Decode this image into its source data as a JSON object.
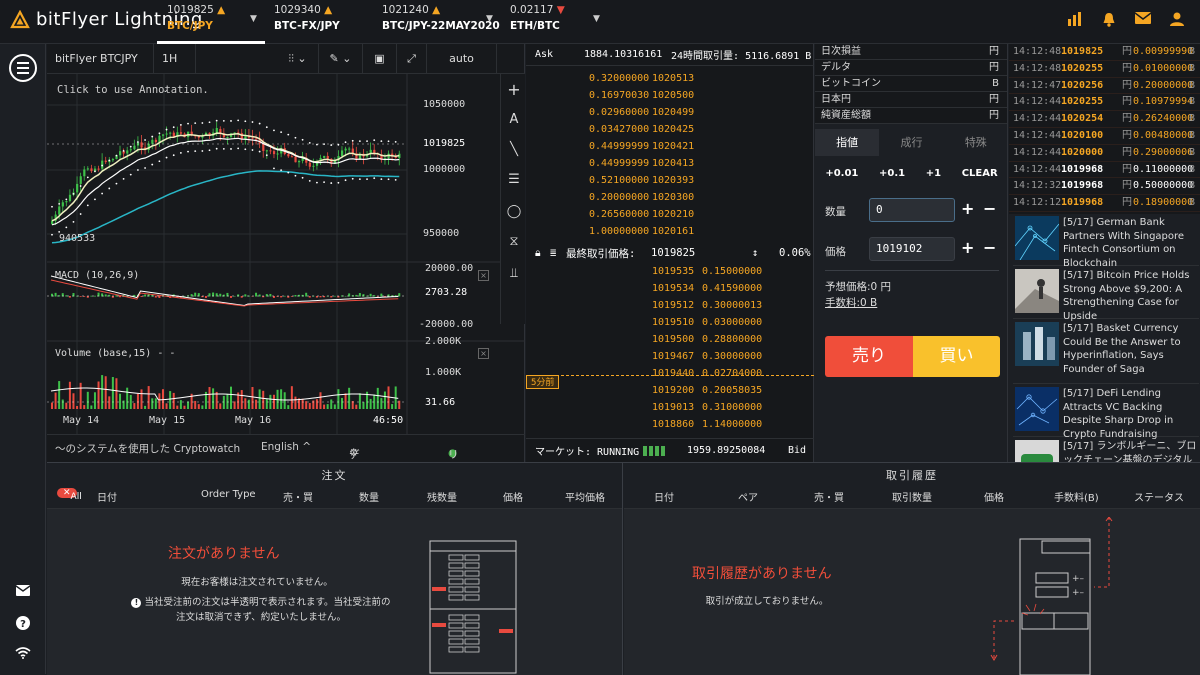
{
  "header": {
    "logo_text": "bitFlyer Lightning",
    "tickers": [
      {
        "price": "1019825",
        "arrow": "up",
        "symbol": "BTC/JPY",
        "active": true
      },
      {
        "price": "1029340",
        "arrow": "up",
        "symbol": "BTC-FX/JPY",
        "active": false
      },
      {
        "price": "1021240",
        "arrow": "up",
        "symbol": "BTC/JPY-22MAY2020",
        "active": false
      },
      {
        "price": "0.02117",
        "arrow": "down",
        "symbol": "ETH/BTC",
        "active": false
      }
    ],
    "icons": [
      "bar-chart-icon",
      "bell-icon",
      "mail-icon",
      "user-icon"
    ],
    "accent_color": "#f5a623"
  },
  "chart": {
    "toolbar": {
      "symbol": "bitFlyer BTCJPY",
      "interval": "1H",
      "auto": "auto"
    },
    "annotation_hint": "Click to use Annotation.",
    "price_labels": [
      "1050000",
      "1019825",
      "1000000",
      "950000"
    ],
    "low_label": "940533",
    "macd": {
      "label": "MACD (10,26,9)",
      "levels": [
        "20000.00",
        "2703.28",
        "-20000.00"
      ]
    },
    "volume": {
      "label": "Volume (base,15) - -",
      "levels": [
        "2.000K",
        "1.000K",
        "31.66"
      ]
    },
    "time_labels": [
      "May 14",
      "May 15",
      "May 16",
      "46:50"
    ],
    "footer": {
      "powered": "〜のシステムを使用した Cryptowatch",
      "language": "English ^",
      "debug": "デバッグ",
      "realtime": "リアルタイム"
    }
  },
  "orderbook": {
    "ask_label": "Ask",
    "ask_value": "1884.10316161",
    "volume_label": "24時間取引量: 5116.6891 B",
    "asks": [
      {
        "size": "0.32000000",
        "price": "1020513"
      },
      {
        "size": "0.16970030",
        "price": "1020500"
      },
      {
        "size": "0.02960000",
        "price": "1020499"
      },
      {
        "size": "0.03427000",
        "price": "1020425"
      },
      {
        "size": "0.44999999",
        "price": "1020421"
      },
      {
        "size": "0.44999999",
        "price": "1020413"
      },
      {
        "size": "0.52100000",
        "price": "1020393"
      },
      {
        "size": "0.20000000",
        "price": "1020300"
      },
      {
        "size": "0.26560000",
        "price": "1020210"
      },
      {
        "size": "1.00000000",
        "price": "1020161"
      }
    ],
    "last_label": "最終取引価格:",
    "last_price": "1019825",
    "last_change": "0.06%",
    "bids": [
      {
        "price": "1019535",
        "size": "0.15000000"
      },
      {
        "price": "1019534",
        "size": "0.41590000"
      },
      {
        "price": "1019512",
        "size": "0.30000013"
      },
      {
        "price": "1019510",
        "size": "0.03000000"
      },
      {
        "price": "1019500",
        "size": "0.28800000"
      },
      {
        "price": "1019467",
        "size": "0.30000000"
      },
      {
        "price": "1019440",
        "size": "0.02704000"
      },
      {
        "price": "1019200",
        "size": "0.20058035"
      },
      {
        "price": "1019013",
        "size": "0.31000000"
      },
      {
        "price": "1018860",
        "size": "1.14000000"
      }
    ],
    "five_min_label": "5分前",
    "market_label": "マーケット: RUNNING",
    "bid_value": "1959.89250084",
    "bid_label": "Bid"
  },
  "balances": [
    {
      "label": "日次損益",
      "unit": "円"
    },
    {
      "label": "デルタ",
      "unit": "円"
    },
    {
      "label": "ビットコイン",
      "unit": "B"
    },
    {
      "label": "日本円",
      "unit": "円"
    },
    {
      "label": "純資産総額",
      "unit": "円"
    }
  ],
  "order_form": {
    "tabs": [
      "指値",
      "成行",
      "特殊"
    ],
    "increments": [
      "+0.01",
      "+0.1",
      "+1",
      "CLEAR"
    ],
    "qty_label": "数量",
    "qty_value": "0",
    "price_label": "価格",
    "price_value": "1019102",
    "est_price": "予想価格:0 円",
    "fee": "手数料:0 B",
    "sell_label": "売り",
    "buy_label": "買い"
  },
  "trades": [
    {
      "time": "14:12:48",
      "price": "1019825",
      "cur": "円",
      "qty": "0.00999990",
      "unit": "B",
      "dir": "up"
    },
    {
      "time": "14:12:48",
      "price": "1020255",
      "cur": "円",
      "qty": "0.01000000",
      "unit": "B",
      "dir": "up"
    },
    {
      "time": "14:12:47",
      "price": "1020256",
      "cur": "円",
      "qty": "0.20000000",
      "unit": "B",
      "dir": "up"
    },
    {
      "time": "14:12:44",
      "price": "1020255",
      "cur": "円",
      "qty": "0.10979994",
      "unit": "B",
      "dir": "up"
    },
    {
      "time": "14:12:44",
      "price": "1020254",
      "cur": "円",
      "qty": "0.26240000",
      "unit": "B",
      "dir": "up"
    },
    {
      "time": "14:12:44",
      "price": "1020100",
      "cur": "円",
      "qty": "0.00480000",
      "unit": "B",
      "dir": "up"
    },
    {
      "time": "14:12:44",
      "price": "1020000",
      "cur": "円",
      "qty": "0.29000006",
      "unit": "B",
      "dir": "up"
    },
    {
      "time": "14:12:44",
      "price": "1019968",
      "cur": "円",
      "qty": "0.11000000",
      "unit": "B",
      "dir": "none"
    },
    {
      "time": "14:12:32",
      "price": "1019968",
      "cur": "円",
      "qty": "0.50000000",
      "unit": "B",
      "dir": "none"
    },
    {
      "time": "14:12:12",
      "price": "1019968",
      "cur": "円",
      "qty": "0.18900000",
      "unit": "B",
      "dir": "up"
    }
  ],
  "news": [
    {
      "text": "[5/17] German Bank Partners With Singapore Fintech Consortium on Blockchain"
    },
    {
      "text": "[5/17] Bitcoin Price Holds Strong Above $9,200: A Strengthening Case for Upside"
    },
    {
      "text": "[5/17] Basket Currency Could Be the Answer to Hyperinflation, Says Founder of Saga"
    },
    {
      "text": "[5/17] DeFi Lending Attracts VC Backing Despite Sharp Drop in Crypto Fundraising"
    },
    {
      "text": "[5/17] ランボルギーニ、ブロックチェーン基盤のデジタルス"
    }
  ],
  "orders_panel": {
    "title": "注文",
    "all_badge": "All",
    "columns": [
      "日付",
      "Order Type",
      "売・買",
      "数量",
      "残数量",
      "価格",
      "平均価格"
    ],
    "empty_title": "注文がありません",
    "empty_sub": "現在お客様は注文されていません。",
    "note_line1": "当社受注前の注文は半透明で表示されます。当社受注前の",
    "note_line2": "注文は取消できず、約定いたしません。"
  },
  "history_panel": {
    "title": "取引履歴",
    "columns": [
      "日付",
      "ペア",
      "売・買",
      "取引数量",
      "価格",
      "手数料(B)",
      "ステータス"
    ],
    "empty_title": "取引履歴がありません",
    "empty_sub": "取引が成立しておりません。"
  },
  "leftbar_icons": [
    "menu-icon",
    "mail-icon",
    "help-icon",
    "wifi-icon"
  ]
}
